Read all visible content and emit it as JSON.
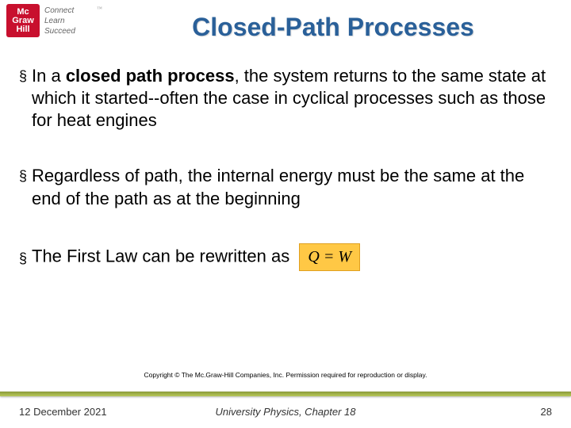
{
  "logo": {
    "line1": "Mc",
    "line2": "Graw",
    "line3": "Hill",
    "tag1": "Connect",
    "tag2": "Learn",
    "tag3": "Succeed",
    "tm": "™"
  },
  "title": "Closed-Path Processes",
  "bullets": {
    "b1_pre": "In a ",
    "b1_bold": "closed path process",
    "b1_post": ", the system returns to the same state at which it started--often the case in cyclical processes such as those for heat engines",
    "b2": "Regardless of path, the internal energy must be the same at the end of the path as at the beginning",
    "b3": "The First Law can be rewritten as"
  },
  "equation": "Q = W",
  "copyright": "Copyright © The Mc.Graw-Hill Companies, Inc. Permission required for reproduction or display.",
  "footer": {
    "date": "12 December 2021",
    "center": "University Physics, Chapter 18",
    "page": "28"
  }
}
